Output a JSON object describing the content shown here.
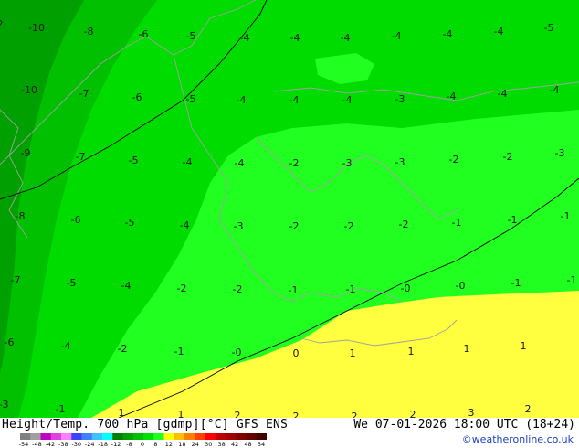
{
  "map": {
    "colors": {
      "dark": "#00a000",
      "mid": "#00c000",
      "light": "#00dc00",
      "bright": "#20ff20",
      "yellow": "#ffff40",
      "border": "#a0a0a0",
      "line": "#000000"
    },
    "labels": [
      {
        "t": "2",
        "p": [
          0,
          30
        ]
      },
      {
        "t": "-10",
        "p": [
          40,
          34
        ]
      },
      {
        "t": "-8",
        "p": [
          97,
          38
        ]
      },
      {
        "t": "-6",
        "p": [
          157,
          41
        ]
      },
      {
        "t": "-5",
        "p": [
          209,
          43
        ]
      },
      {
        "t": "-4",
        "p": [
          268,
          45
        ]
      },
      {
        "t": "-4",
        "p": [
          323,
          45
        ]
      },
      {
        "t": "-4",
        "p": [
          378,
          45
        ]
      },
      {
        "t": "-4",
        "p": [
          434,
          43
        ]
      },
      {
        "t": "-4",
        "p": [
          490,
          41
        ]
      },
      {
        "t": "-4",
        "p": [
          546,
          38
        ]
      },
      {
        "t": "-5",
        "p": [
          601,
          34
        ]
      },
      {
        "t": "-10",
        "p": [
          32,
          102
        ]
      },
      {
        "t": "-7",
        "p": [
          92,
          106
        ]
      },
      {
        "t": "-6",
        "p": [
          150,
          110
        ]
      },
      {
        "t": "-5",
        "p": [
          209,
          112
        ]
      },
      {
        "t": "-4",
        "p": [
          264,
          113
        ]
      },
      {
        "t": "-4",
        "p": [
          322,
          113
        ]
      },
      {
        "t": "-4",
        "p": [
          380,
          113
        ]
      },
      {
        "t": "-3",
        "p": [
          438,
          112
        ]
      },
      {
        "t": "-4",
        "p": [
          494,
          109
        ]
      },
      {
        "t": "-4",
        "p": [
          550,
          106
        ]
      },
      {
        "t": "-4",
        "p": [
          607,
          102
        ]
      },
      {
        "t": "-9",
        "p": [
          28,
          171
        ]
      },
      {
        "t": "-7",
        "p": [
          88,
          175
        ]
      },
      {
        "t": "-5",
        "p": [
          146,
          179
        ]
      },
      {
        "t": "-4",
        "p": [
          205,
          181
        ]
      },
      {
        "t": "-4",
        "p": [
          262,
          182
        ]
      },
      {
        "t": "-2",
        "p": [
          322,
          182
        ]
      },
      {
        "t": "-3",
        "p": [
          380,
          182
        ]
      },
      {
        "t": "-3",
        "p": [
          438,
          181
        ]
      },
      {
        "t": "-2",
        "p": [
          497,
          178
        ]
      },
      {
        "t": "-2",
        "p": [
          556,
          175
        ]
      },
      {
        "t": "-3",
        "p": [
          613,
          171
        ]
      },
      {
        "t": "-8",
        "p": [
          22,
          240
        ]
      },
      {
        "t": "-6",
        "p": [
          83,
          244
        ]
      },
      {
        "t": "-5",
        "p": [
          142,
          247
        ]
      },
      {
        "t": "-4",
        "p": [
          202,
          250
        ]
      },
      {
        "t": "-3",
        "p": [
          261,
          251
        ]
      },
      {
        "t": "-2",
        "p": [
          322,
          251
        ]
      },
      {
        "t": "-2",
        "p": [
          382,
          251
        ]
      },
      {
        "t": "-2",
        "p": [
          442,
          249
        ]
      },
      {
        "t": "-1",
        "p": [
          500,
          247
        ]
      },
      {
        "t": "-1",
        "p": [
          561,
          244
        ]
      },
      {
        "t": "-1",
        "p": [
          619,
          240
        ]
      },
      {
        "t": "-7",
        "p": [
          17,
          310
        ]
      },
      {
        "t": "-5",
        "p": [
          78,
          313
        ]
      },
      {
        "t": "-4",
        "p": [
          138,
          316
        ]
      },
      {
        "t": "-2",
        "p": [
          199,
          319
        ]
      },
      {
        "t": "-2",
        "p": [
          260,
          320
        ]
      },
      {
        "t": "-1",
        "p": [
          321,
          321
        ]
      },
      {
        "t": "-1",
        "p": [
          384,
          320
        ]
      },
      {
        "t": "-0",
        "p": [
          444,
          319
        ]
      },
      {
        "t": "-0",
        "p": [
          504,
          316
        ]
      },
      {
        "t": "-1",
        "p": [
          565,
          313
        ]
      },
      {
        "t": "-1",
        "p": [
          626,
          310
        ]
      },
      {
        "t": "-6",
        "p": [
          10,
          378
        ]
      },
      {
        "t": "-4",
        "p": [
          72,
          382
        ]
      },
      {
        "t": "-2",
        "p": [
          134,
          385
        ]
      },
      {
        "t": "-1",
        "p": [
          196,
          388
        ]
      },
      {
        "t": "-0",
        "p": [
          259,
          389
        ]
      },
      {
        "t": "0",
        "p": [
          324,
          390
        ]
      },
      {
        "t": "1",
        "p": [
          386,
          390
        ]
      },
      {
        "t": "1",
        "p": [
          450,
          388
        ]
      },
      {
        "t": "1",
        "p": [
          511,
          385
        ]
      },
      {
        "t": "1",
        "p": [
          573,
          382
        ]
      },
      {
        "t": "-3",
        "p": [
          4,
          446
        ]
      },
      {
        "t": "-1",
        "p": [
          66,
          451
        ]
      },
      {
        "t": "1",
        "p": [
          133,
          455
        ]
      },
      {
        "t": "1",
        "p": [
          198,
          457
        ]
      },
      {
        "t": "2",
        "p": [
          260,
          458
        ]
      },
      {
        "t": "2",
        "p": [
          324,
          459
        ]
      },
      {
        "t": "2",
        "p": [
          388,
          459
        ]
      },
      {
        "t": "2",
        "p": [
          452,
          457
        ]
      },
      {
        "t": "3",
        "p": [
          516,
          455
        ]
      },
      {
        "t": "2",
        "p": [
          578,
          451
        ]
      }
    ]
  },
  "footer": {
    "title": "Height/Temp. 700 hPa [gdmp][°C] GFS ENS",
    "valid": "We 07-01-2026 18:00 UTC (18+24)",
    "credit": "©weatheronline.co.uk"
  },
  "colorbar": {
    "colors": [
      "#808080",
      "#a0a0a0",
      "#c000c0",
      "#e040e0",
      "#ff80ff",
      "#4040ff",
      "#4080ff",
      "#40c0ff",
      "#00ffff",
      "#008000",
      "#00a000",
      "#00c000",
      "#00e000",
      "#20ff20",
      "#ffff00",
      "#ffc000",
      "#ff8000",
      "#ff4000",
      "#ff0000",
      "#c00000",
      "#a00000",
      "#800000",
      "#600000",
      "#400000"
    ],
    "ticks": [
      "-54",
      "-48",
      "-42",
      "-38",
      "-30",
      "-24",
      "-18",
      "-12",
      "-8",
      "0",
      "8",
      "12",
      "18",
      "24",
      "30",
      "38",
      "42",
      "48",
      "54"
    ]
  }
}
